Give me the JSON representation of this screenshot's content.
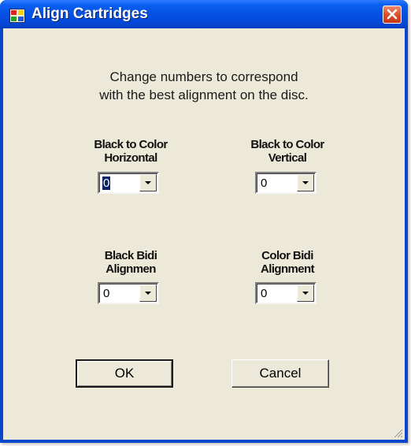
{
  "window": {
    "title": "Align Cartridges",
    "instruction_line1": "Change numbers to correspond",
    "instruction_line2": "with the best alignment on the disc."
  },
  "groups": [
    {
      "label_line1": "Black to Color",
      "label_line2": "Horizontal",
      "value": "0",
      "focused": true
    },
    {
      "label_line1": "Black to Color",
      "label_line2": "Vertical",
      "value": "0"
    },
    {
      "label_line1": "Black Bidi",
      "label_line2": "Alignmen",
      "value": "0"
    },
    {
      "label_line1": "Color Bidi",
      "label_line2": "Alignment",
      "value": "0"
    }
  ],
  "buttons": {
    "ok": "OK",
    "cancel": "Cancel"
  },
  "icons": {
    "app": "app-icon",
    "close": "close-icon",
    "dropdown": "chevron-down-icon",
    "grip": "resize-grip-icon"
  },
  "colors": {
    "titlebar": "#0552e6",
    "face": "#ece9d8",
    "close": "#d94c23",
    "selection": "#0a246a"
  }
}
